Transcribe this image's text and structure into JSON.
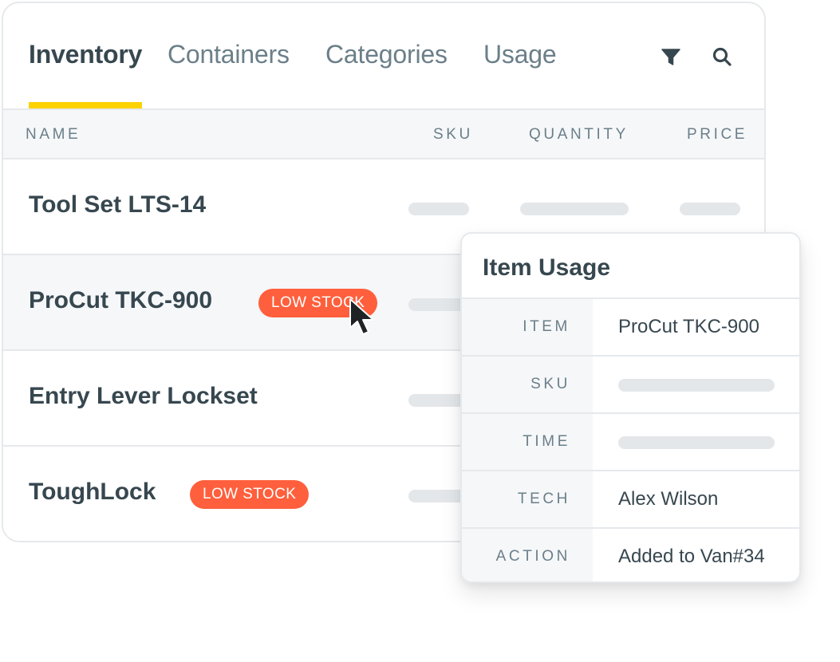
{
  "tabs": [
    {
      "label": "Inventory",
      "active": true
    },
    {
      "label": "Containers",
      "active": false
    },
    {
      "label": "Categories",
      "active": false
    },
    {
      "label": "Usage",
      "active": false
    }
  ],
  "toolbar": {
    "filter_icon": "filter-icon",
    "search_icon": "search-icon"
  },
  "colors": {
    "accent": "#fcd200",
    "badge": "#ff5f3c",
    "text_primary": "#37474f",
    "text_muted": "#6b7f89",
    "row_hover": "#f5f7f9",
    "skeleton": "#e4e7ea"
  },
  "table": {
    "columns": [
      "NAME",
      "SKU",
      "QUANTITY",
      "PRICE"
    ],
    "rows": [
      {
        "name": "Tool Set LTS-14",
        "badge": null
      },
      {
        "name": "ProCut TKC-900",
        "badge": "LOW STOCK",
        "hovered": true
      },
      {
        "name": "Entry Lever Lockset",
        "badge": null
      },
      {
        "name": "ToughLock",
        "badge": "LOW STOCK"
      }
    ]
  },
  "popover": {
    "title": "Item Usage",
    "fields": [
      {
        "label": "ITEM",
        "value": "ProCut TKC-900"
      },
      {
        "label": "SKU",
        "value": null
      },
      {
        "label": "TIME",
        "value": null
      },
      {
        "label": "TECH",
        "value": "Alex Wilson"
      },
      {
        "label": "ACTION",
        "value": "Added to Van#34"
      }
    ]
  },
  "cursor": "arrow-cursor-icon"
}
